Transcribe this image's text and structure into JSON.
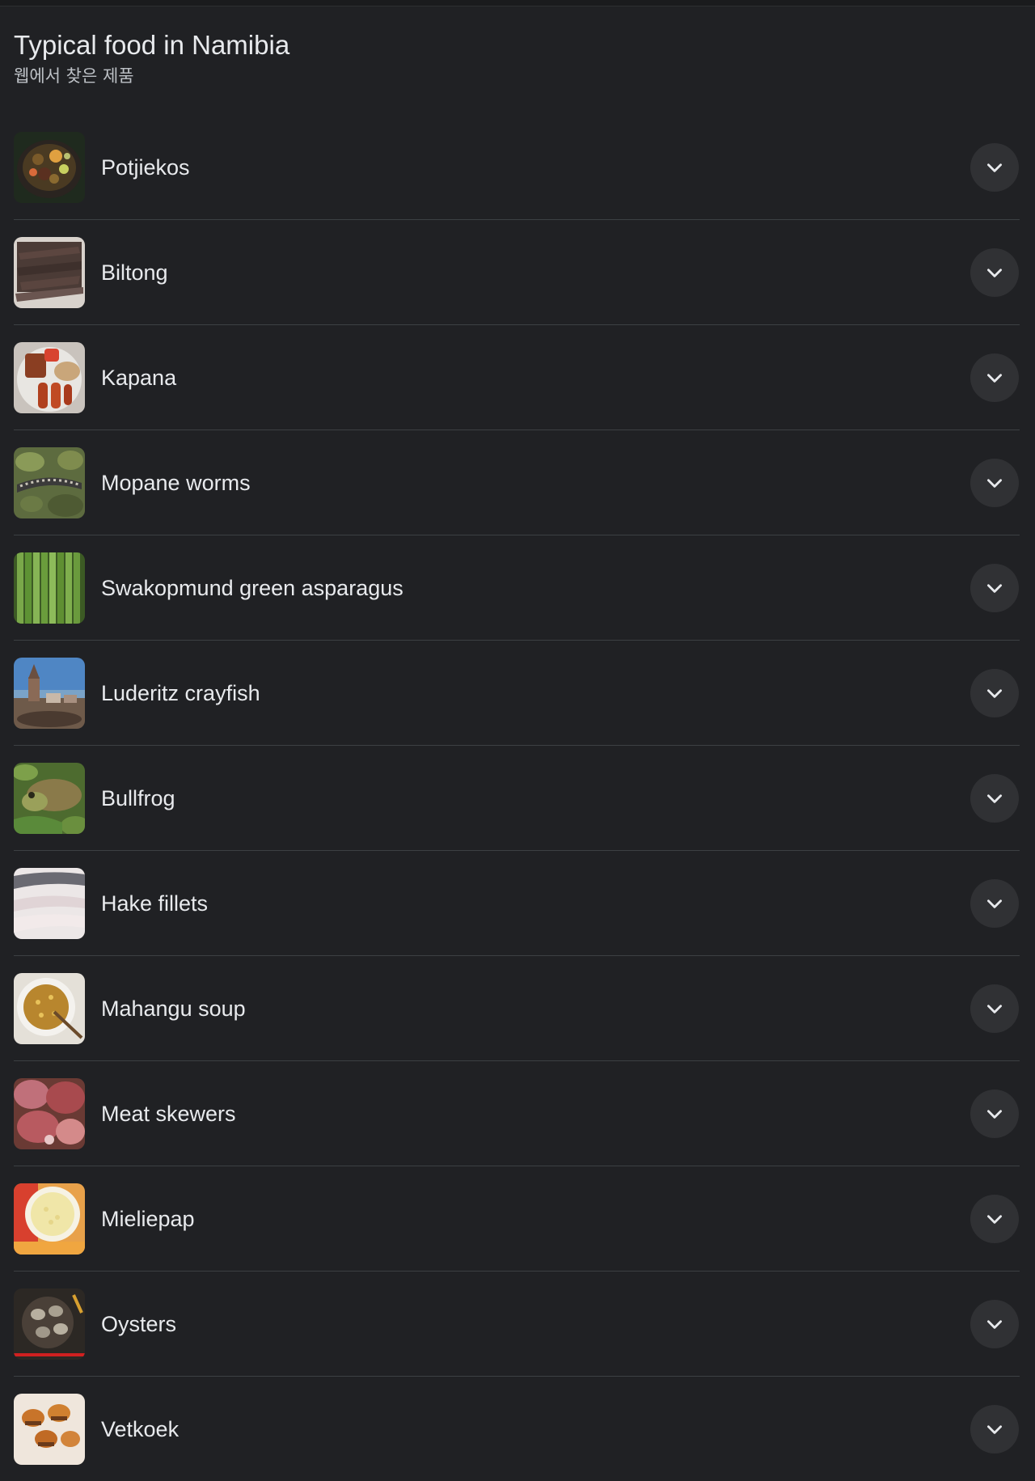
{
  "card": {
    "title": "Typical food in Namibia",
    "subtitle": "웹에서 찾은 제품"
  },
  "items": [
    {
      "label": "Potjiekos",
      "thumb_icon": "stew-pot-photo",
      "thumb_color": "#4a3a22"
    },
    {
      "label": "Biltong",
      "thumb_icon": "dried-meat-photo",
      "thumb_color": "#4b3b36"
    },
    {
      "label": "Kapana",
      "thumb_icon": "grilled-meat-plate-photo",
      "thumb_color": "#b9b2ac"
    },
    {
      "label": "Mopane worms",
      "thumb_icon": "caterpillar-photo",
      "thumb_color": "#5d6b3f"
    },
    {
      "label": "Swakopmund green asparagus",
      "thumb_icon": "asparagus-photo",
      "thumb_color": "#5d8a36"
    },
    {
      "label": "Luderitz crayfish",
      "thumb_icon": "town-coast-photo",
      "thumb_color": "#5e7ea0"
    },
    {
      "label": "Bullfrog",
      "thumb_icon": "bullfrog-photo",
      "thumb_color": "#6b7b45"
    },
    {
      "label": "Hake fillets",
      "thumb_icon": "fish-fillet-photo",
      "thumb_color": "#e2dcdc"
    },
    {
      "label": "Mahangu soup",
      "thumb_icon": "soup-bowl-photo",
      "thumb_color": "#d9d4c9"
    },
    {
      "label": "Meat skewers",
      "thumb_icon": "raw-meat-photo",
      "thumb_color": "#9d5a56"
    },
    {
      "label": "Mieliepap",
      "thumb_icon": "maize-porridge-photo",
      "thumb_color": "#e8a14a"
    },
    {
      "label": "Oysters",
      "thumb_icon": "oysters-photo",
      "thumb_color": "#3c3630"
    },
    {
      "label": "Vetkoek",
      "thumb_icon": "fried-dough-photo",
      "thumb_color": "#e7d8c8"
    }
  ]
}
